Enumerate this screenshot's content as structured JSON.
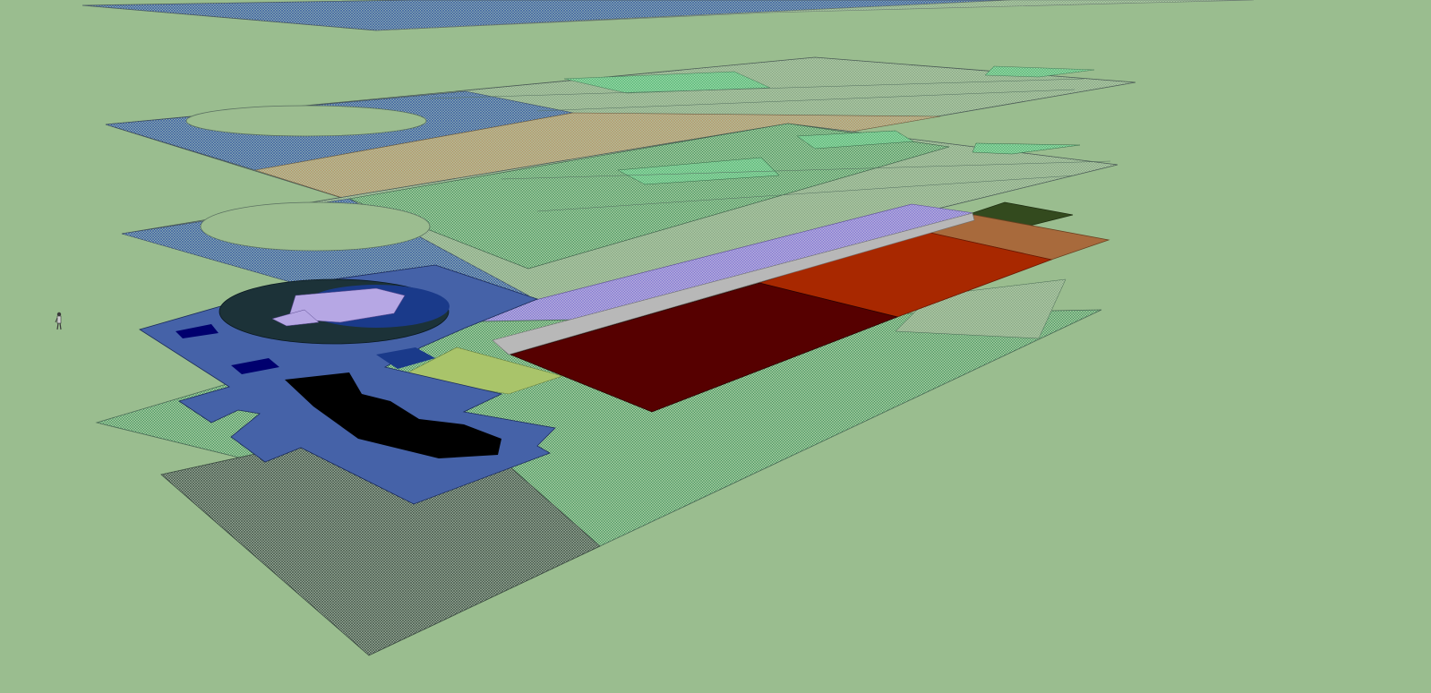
{
  "scene": {
    "background_color": "#9abd8f",
    "icons": {
      "scale_figure": "person-figure-icon"
    },
    "colors": {
      "hatch_blue": "#2c4fa3",
      "hatch_green": "#3f8f5a",
      "hatch_dark": "#3a4a40",
      "hatch_tan": "#b58f5f",
      "hatch_mint": "#6fcf8a",
      "hatch_lavender": "#a79ae0",
      "plaza_blue": "#4562a8",
      "plaza_navy": "#1a3a8a",
      "ring_dark": "#1c3238",
      "pond_black": "#000000",
      "slab_maroon": "#560000",
      "slab_red": "#a82800",
      "slab_orange": "#a86a3c",
      "slab_olive": "#334a1e",
      "walkway_gray": "#b8b8b8",
      "lawn_yellow_green": "#a9c46a",
      "navy_square": "#00006e",
      "lilac_strip": "#b6a7e4"
    }
  }
}
